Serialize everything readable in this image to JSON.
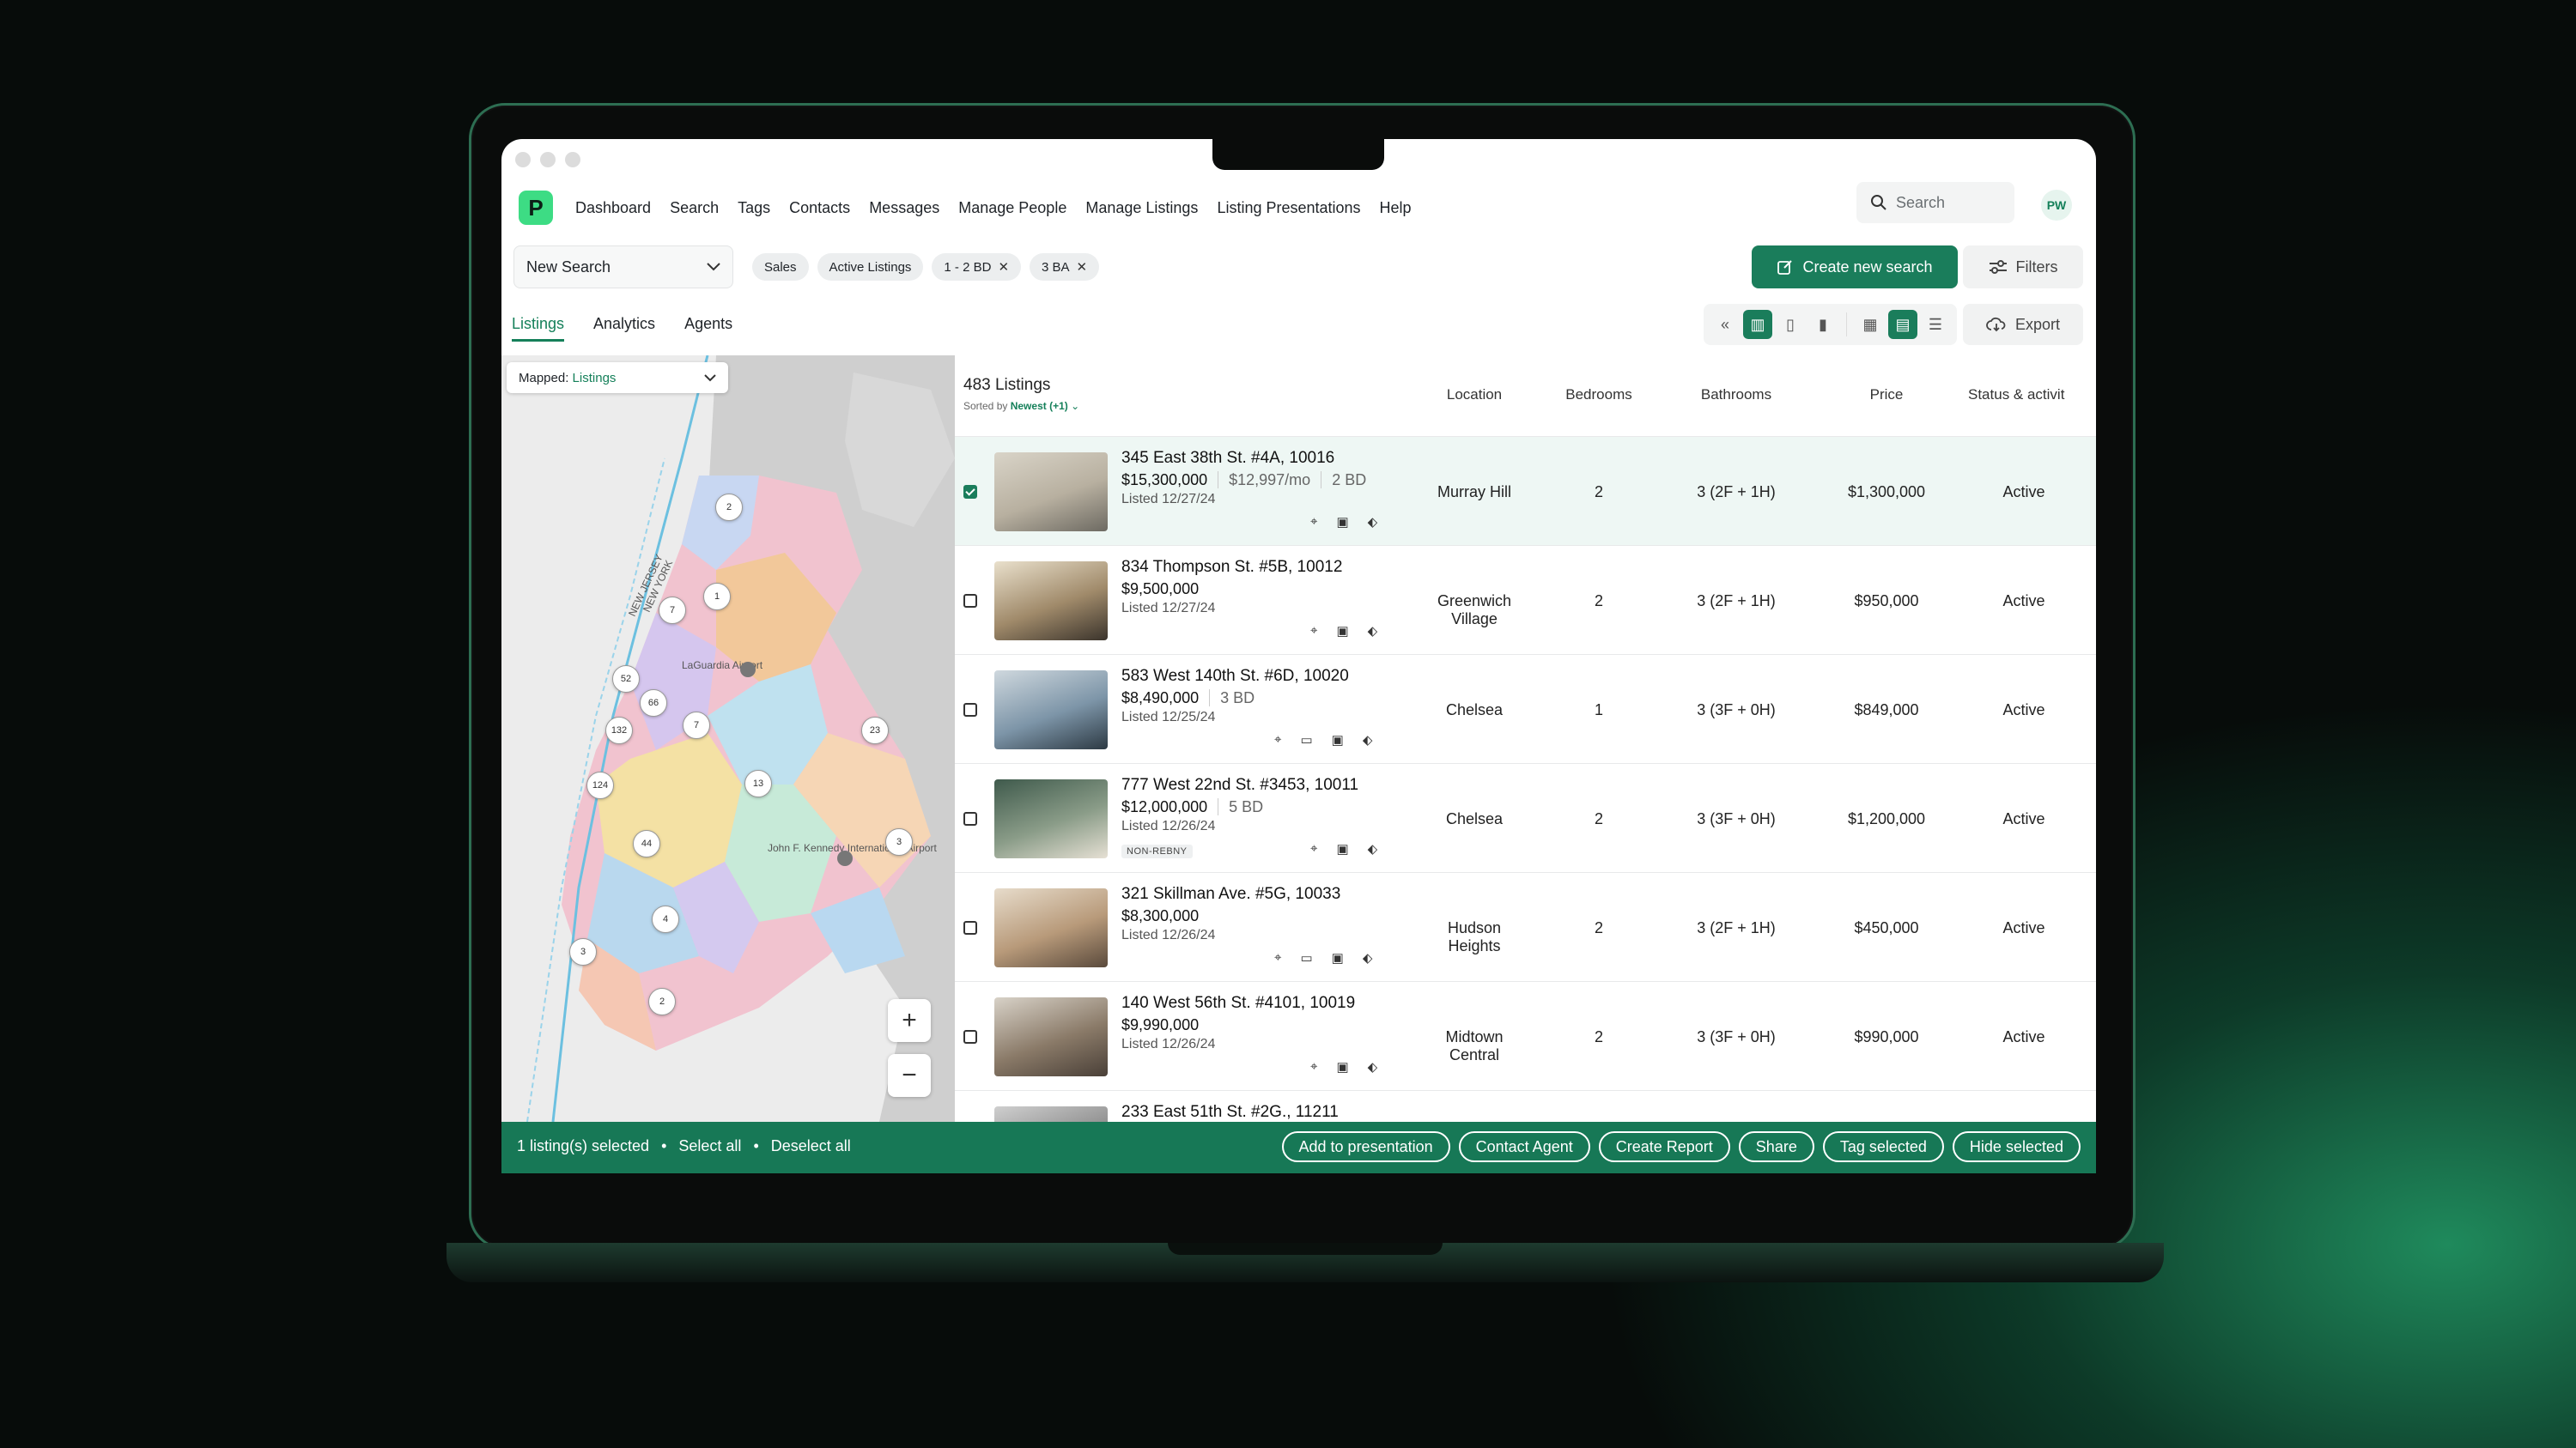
{
  "nav": {
    "items": [
      "Dashboard",
      "Search",
      "Tags",
      "Contacts",
      "Messages",
      "Manage People",
      "Manage Listings",
      "Listing Presentations",
      "Help"
    ],
    "search_placeholder": "Search",
    "avatar": "PW",
    "logo": "P"
  },
  "search_bar": {
    "saved_search": "New Search",
    "chips": [
      {
        "label": "Sales",
        "removable": false
      },
      {
        "label": "Active Listings",
        "removable": false
      },
      {
        "label": "1 - 2 BD",
        "removable": true
      },
      {
        "label": "3 BA",
        "removable": true
      }
    ],
    "create_label": "Create new search",
    "filters_label": "Filters"
  },
  "tabs": [
    "Listings",
    "Analytics",
    "Agents"
  ],
  "export_label": "Export",
  "map": {
    "mapped_prefix": "Mapped:",
    "mapped_value": "Listings",
    "labels": [
      "NEW JERSEY",
      "NEW YORK",
      "LaGuardia Airport",
      "John F. Kennedy International Airport"
    ],
    "clusters": [
      "2",
      "1",
      "7",
      "52",
      "66",
      "132",
      "7",
      "23",
      "124",
      "13",
      "44",
      "3",
      "4",
      "3",
      "2"
    ]
  },
  "table": {
    "count": "483 Listings",
    "sorted_prefix": "Sorted by",
    "sorted_value": "Newest (+1)",
    "headers": {
      "location": "Location",
      "bedrooms": "Bedrooms",
      "bathrooms": "Bathrooms",
      "price": "Price",
      "status": "Status & activit"
    },
    "rows": [
      {
        "address": "345 East 38th St. #4A, 10016",
        "price": "$15,300,000",
        "sub": [
          "$12,997/mo",
          "2 BD"
        ],
        "listed": "Listed 12/27/24",
        "badge": "",
        "location": "Murray Hill",
        "bedrooms": "2",
        "bathrooms": "3 (2F + 1H)",
        "list_price": "$1,300,000",
        "status": "Active",
        "selected": true
      },
      {
        "address": "834 Thompson St. #5B, 10012",
        "price": "$9,500,000",
        "sub": [],
        "listed": "Listed 12/27/24",
        "badge": "",
        "location": "Greenwich Village",
        "bedrooms": "2",
        "bathrooms": "3 (2F + 1H)",
        "list_price": "$950,000",
        "status": "Active",
        "selected": false
      },
      {
        "address": "583 West 140th St. #6D, 10020",
        "price": "$8,490,000",
        "sub": [
          "3 BD"
        ],
        "listed": "Listed 12/25/24",
        "badge": "",
        "location": "Chelsea",
        "bedrooms": "1",
        "bathrooms": "3 (3F + 0H)",
        "list_price": "$849,000",
        "status": "Active",
        "selected": false
      },
      {
        "address": "777 West 22nd St. #3453, 10011",
        "price": "$12,000,000",
        "sub": [
          "5 BD"
        ],
        "listed": "Listed 12/26/24",
        "badge": "NON-REBNY",
        "location": "Chelsea",
        "bedrooms": "2",
        "bathrooms": "3 (3F + 0H)",
        "list_price": "$1,200,000",
        "status": "Active",
        "selected": false
      },
      {
        "address": "321 Skillman Ave. #5G, 10033",
        "price": "$8,300,000",
        "sub": [],
        "listed": "Listed 12/26/24",
        "badge": "",
        "location": "Hudson Heights",
        "bedrooms": "2",
        "bathrooms": "3 (2F + 1H)",
        "list_price": "$450,000",
        "status": "Active",
        "selected": false
      },
      {
        "address": "140 West 56th St. #4101, 10019",
        "price": "$9,990,000",
        "sub": [],
        "listed": "Listed 12/26/24",
        "badge": "",
        "location": "Midtown Central",
        "bedrooms": "2",
        "bathrooms": "3 (3F + 0H)",
        "list_price": "$990,000",
        "status": "Active",
        "selected": false
      },
      {
        "address": "233 East 51th St. #2G., 11211",
        "price": "",
        "sub": [],
        "listed": "",
        "badge": "",
        "location": "",
        "bedrooms": "",
        "bathrooms": "",
        "list_price": "",
        "status": "",
        "selected": false
      }
    ]
  },
  "bottom_bar": {
    "selected_text": "1 listing(s) selected",
    "select_all": "Select all",
    "deselect_all": "Deselect all",
    "actions": [
      "Add to presentation",
      "Contact Agent",
      "Create Report",
      "Share",
      "Tag selected",
      "Hide selected"
    ]
  },
  "colors": {
    "accent": "#1a7d5b",
    "logo": "#3ddc84",
    "bar": "#177856"
  }
}
